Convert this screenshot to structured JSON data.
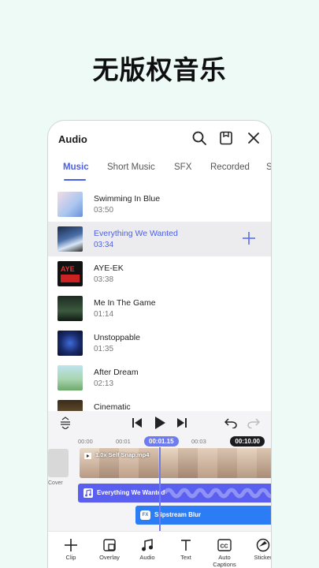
{
  "headline": "无版权音乐",
  "header": {
    "title": "Audio",
    "icons": [
      "search-icon",
      "save-icon",
      "close-icon"
    ]
  },
  "tabs": [
    {
      "label": "Music",
      "active": true
    },
    {
      "label": "Short Music",
      "active": false
    },
    {
      "label": "SFX",
      "active": false
    },
    {
      "label": "Recorded",
      "active": false
    },
    {
      "label": "S",
      "active": false
    }
  ],
  "tracks": [
    {
      "name": "Swimming In Blue",
      "duration": "03:50"
    },
    {
      "name": "Everything We Wanted",
      "duration": "03:34",
      "selected": true
    },
    {
      "name": "AYE-EK",
      "duration": "03:38"
    },
    {
      "name": "Me In The Game",
      "duration": "01:14"
    },
    {
      "name": "Unstoppable",
      "duration": "01:35"
    },
    {
      "name": "After Dream",
      "duration": "02:13"
    },
    {
      "name": "Cinematic",
      "duration": ""
    }
  ],
  "editor": {
    "ruler": [
      "00:00",
      "00:01",
      "00:03"
    ],
    "playhead_time": "00:01.15",
    "total_time": "00:10.00",
    "cover_label": "Cover",
    "video_clip": "1.0x Self Snap.mp4",
    "audio_clip": "Everything We Wanted",
    "fx_clip": "Slipstream Blur",
    "fx_badge": "FX"
  },
  "toolbar": [
    {
      "label": "Clip",
      "icon": "plus-icon"
    },
    {
      "label": "Overlay",
      "icon": "overlay-icon"
    },
    {
      "label": "Audio",
      "icon": "music-note-icon"
    },
    {
      "label": "Text",
      "icon": "text-icon"
    },
    {
      "label": "Auto Captions",
      "icon": "captions-icon"
    },
    {
      "label": "Sticker",
      "icon": "sticker-icon"
    }
  ],
  "colors": {
    "accent": "#4a5ee8",
    "audio_track": "#5b5ff0",
    "fx_track": "#2c7df5",
    "background": "#eefaf6"
  }
}
